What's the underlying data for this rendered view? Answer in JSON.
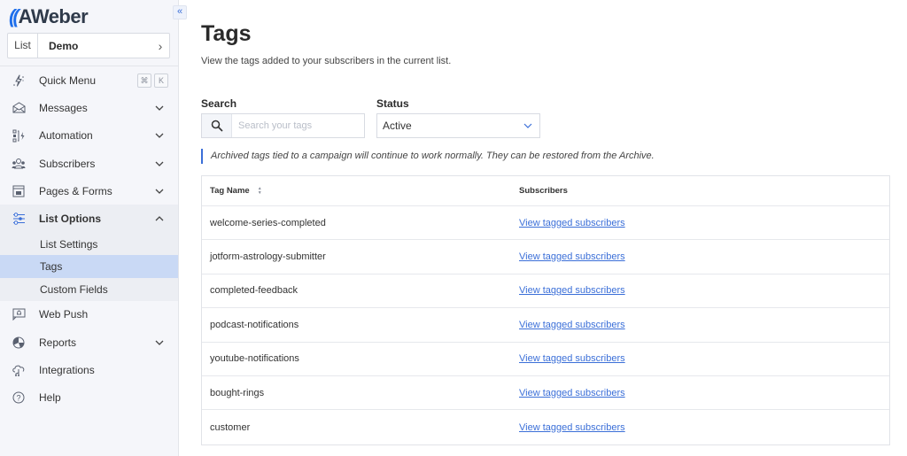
{
  "app": {
    "brand": "AWeber",
    "collapse_icon": "«"
  },
  "list_selector": {
    "label": "List",
    "value": "Demo",
    "chevron": "›"
  },
  "sidebar": {
    "items": [
      {
        "label": "Quick Menu",
        "icon": "lightning-icon",
        "shortcut": [
          "⌘",
          "K"
        ]
      },
      {
        "label": "Messages",
        "icon": "envelope-icon",
        "expandable": true
      },
      {
        "label": "Automation",
        "icon": "automation-icon",
        "expandable": true
      },
      {
        "label": "Subscribers",
        "icon": "users-icon",
        "expandable": true
      },
      {
        "label": "Pages & Forms",
        "icon": "page-form-icon",
        "expandable": true
      },
      {
        "label": "List Options",
        "icon": "sliders-icon",
        "expandable": true,
        "expanded": true,
        "children": [
          {
            "label": "List Settings"
          },
          {
            "label": "Tags",
            "selected": true
          },
          {
            "label": "Custom Fields"
          }
        ]
      },
      {
        "label": "Web Push",
        "icon": "web-push-icon"
      },
      {
        "label": "Reports",
        "icon": "pie-chart-icon",
        "expandable": true
      },
      {
        "label": "Integrations",
        "icon": "cloud-icon"
      },
      {
        "label": "Help",
        "icon": "help-icon"
      }
    ]
  },
  "page": {
    "title": "Tags",
    "subtitle": "View the tags added to your subscribers in the current list.",
    "search": {
      "label": "Search",
      "placeholder": "Search your tags",
      "value": ""
    },
    "status": {
      "label": "Status",
      "value": "Active"
    },
    "notice": "Archived tags tied to a campaign will continue to work normally. They can be restored from the Archive."
  },
  "table": {
    "columns": [
      "Tag Name",
      "Subscribers"
    ],
    "rows": [
      {
        "name": "welcome-series-completed",
        "link": "View tagged subscribers"
      },
      {
        "name": "jotform-astrology-submitter",
        "link": "View tagged subscribers"
      },
      {
        "name": "completed-feedback",
        "link": "View tagged subscribers"
      },
      {
        "name": "podcast-notifications",
        "link": "View tagged subscribers"
      },
      {
        "name": "youtube-notifications",
        "link": "View tagged subscribers"
      },
      {
        "name": "bought-rings",
        "link": "View tagged subscribers"
      },
      {
        "name": "customer",
        "link": "View tagged subscribers"
      }
    ]
  },
  "colors": {
    "accent": "#3b6fd8",
    "selected_bg": "#c9d9f5",
    "sidebar_bg": "#f5f6fa"
  }
}
